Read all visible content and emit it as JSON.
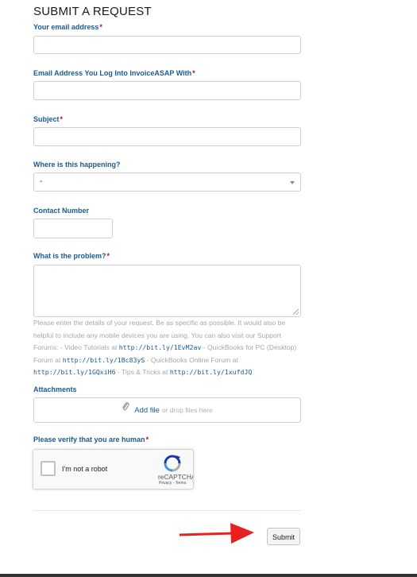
{
  "page": {
    "title": "SUBMIT A REQUEST"
  },
  "form": {
    "email": {
      "label": "Your email address",
      "required_mark": "*",
      "value": ""
    },
    "login_email": {
      "label": "Email Address You Log Into InvoiceASAP With",
      "required_mark": "*",
      "value": ""
    },
    "subject": {
      "label": "Subject",
      "required_mark": "*",
      "value": ""
    },
    "where": {
      "label": "Where is this happening?",
      "selected": "-"
    },
    "contact": {
      "label": "Contact Number",
      "value": ""
    },
    "problem": {
      "label": "What is the problem?",
      "required_mark": "*",
      "value": ""
    },
    "help": {
      "t1": "Please enter the details of your request. Be as specific as possible. It would also be helpful to include any mobile devices you are using. You can also visit our Support Forums: - Video Tutorials at ",
      "link1": "http://bit.ly/1EvM2av",
      "t2": " - QuickBooks for PC (Desktop) Forum at ",
      "link2": "http://bit.ly/1Bc83yS",
      "t3": " - QuickBooks Online Forum at ",
      "link3": "http://bit.ly/1GQxiH6",
      "t4": " - Tips & Tricks at ",
      "link4": "http://bit.ly/1xufdJQ"
    },
    "attachments": {
      "label": "Attachments",
      "add_file": "Add file",
      "drop_text": "or drop files here"
    },
    "verify": {
      "label": "Please verify that you are human",
      "required_mark": "*"
    },
    "captcha": {
      "checkbox_label": "I'm not a robot",
      "brand": "reCAPTCHA",
      "terms": "Privacy - Terms"
    },
    "submit_label": "Submit"
  },
  "colors": {
    "label_blue": "#1b5a94",
    "required_red": "#d0021b",
    "annotation_arrow": "#e8201f"
  }
}
